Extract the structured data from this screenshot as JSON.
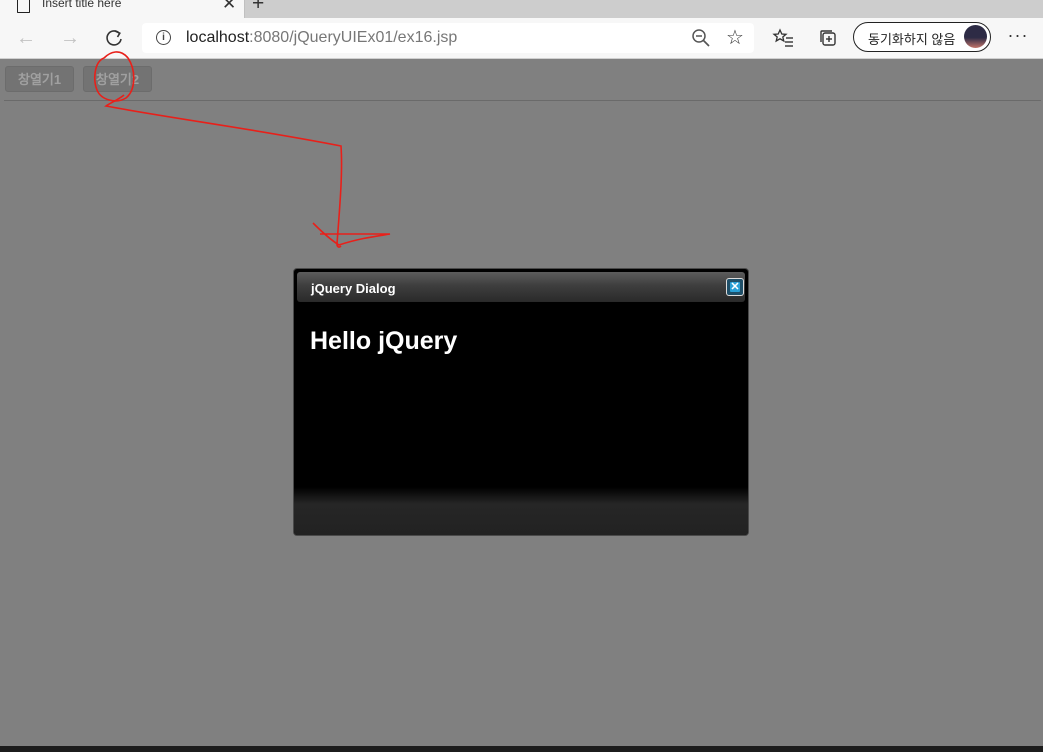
{
  "browser": {
    "tab": {
      "title": "Insert title here"
    },
    "address": {
      "host": "localhost",
      "path": ":8080/jQueryUIEx01/ex16.jsp"
    },
    "sync_button": {
      "label": "동기화하지 않음"
    }
  },
  "page": {
    "buttons": [
      {
        "label": "창열기1"
      },
      {
        "label": "창열기2"
      }
    ]
  },
  "dialog": {
    "title": "jQuery Dialog",
    "content": "Hello jQuery"
  },
  "colors": {
    "overlay": "#808080",
    "annotation": "#e8201a",
    "dialog_bg": "#000000",
    "close_accent": "#2aa0d6"
  }
}
